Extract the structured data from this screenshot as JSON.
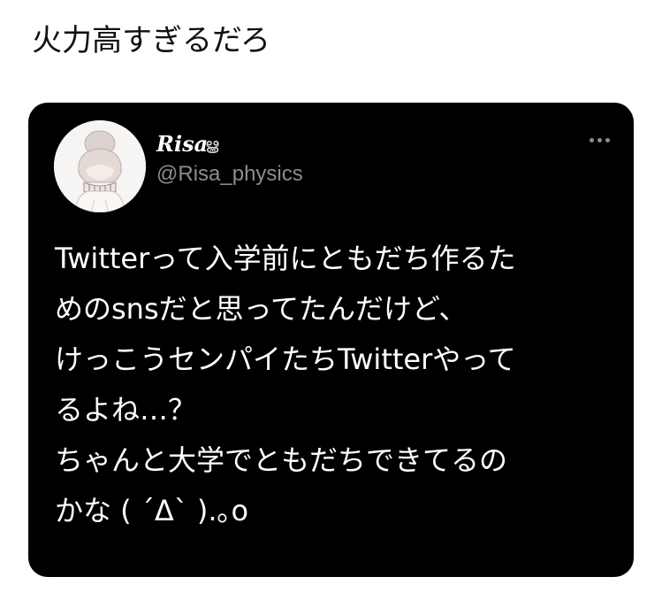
{
  "caption": "火力高すぎるだろ",
  "tweet": {
    "display_name": "Risa",
    "name_emoji": "ൠ",
    "handle": "@Risa_physics",
    "more_icon": "more-horizontal-icon",
    "avatar_icon": "illustrated-girl-avatar",
    "lines": [
      "Twitterって入学前にともだち作るた",
      "めのsnsだと思ってたんだけど、",
      "けっこうセンパイたちTwitterやって",
      "るよね…？",
      "ちゃんと大学でともだちできてるの",
      "かな ( ´Δ` ).｡o"
    ]
  },
  "colors": {
    "page_background": "#ffffff",
    "card_background": "#000000",
    "text_primary": "#ffffff",
    "text_secondary": "#8b8d92",
    "caption_text": "#111111"
  }
}
